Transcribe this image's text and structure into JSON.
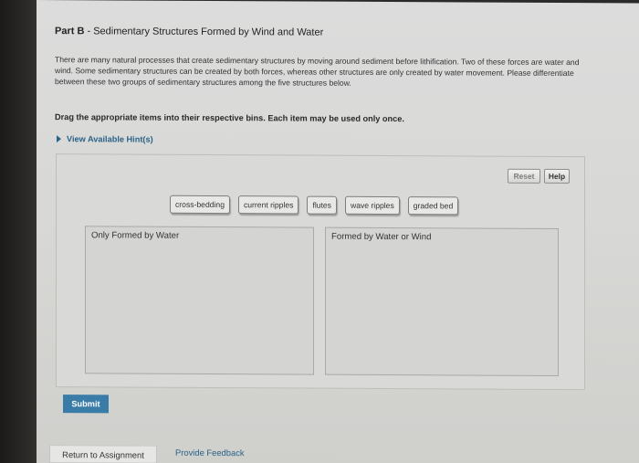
{
  "part": {
    "label": "Part B",
    "separator": " - ",
    "title": "Sedimentary Structures Formed by Wind and Water"
  },
  "intro_text": "There are many natural processes that create sedimentary structures by moving around sediment before lithification. Two of these forces are water and wind. Some sedimentary structures can be created by both forces, whereas other structures are only created by water movement. Please differentiate between these two groups of sedimentary structures among the five structures below.",
  "instruction": "Drag the appropriate items into their respective bins. Each item may be used only once.",
  "hints_label": "View Available Hint(s)",
  "toolbar": {
    "reset_label": "Reset",
    "help_label": "Help"
  },
  "items": [
    "cross-bedding",
    "current ripples",
    "flutes",
    "wave ripples",
    "graded bed"
  ],
  "bins": {
    "water_only": "Only Formed by Water",
    "water_or_wind": "Formed by Water or Wind"
  },
  "submit_label": "Submit",
  "footer": {
    "return_label": "Return to Assignment",
    "feedback_label": "Provide Feedback"
  },
  "colors": {
    "accent": "#3a7ca8",
    "link": "#2a6387"
  }
}
